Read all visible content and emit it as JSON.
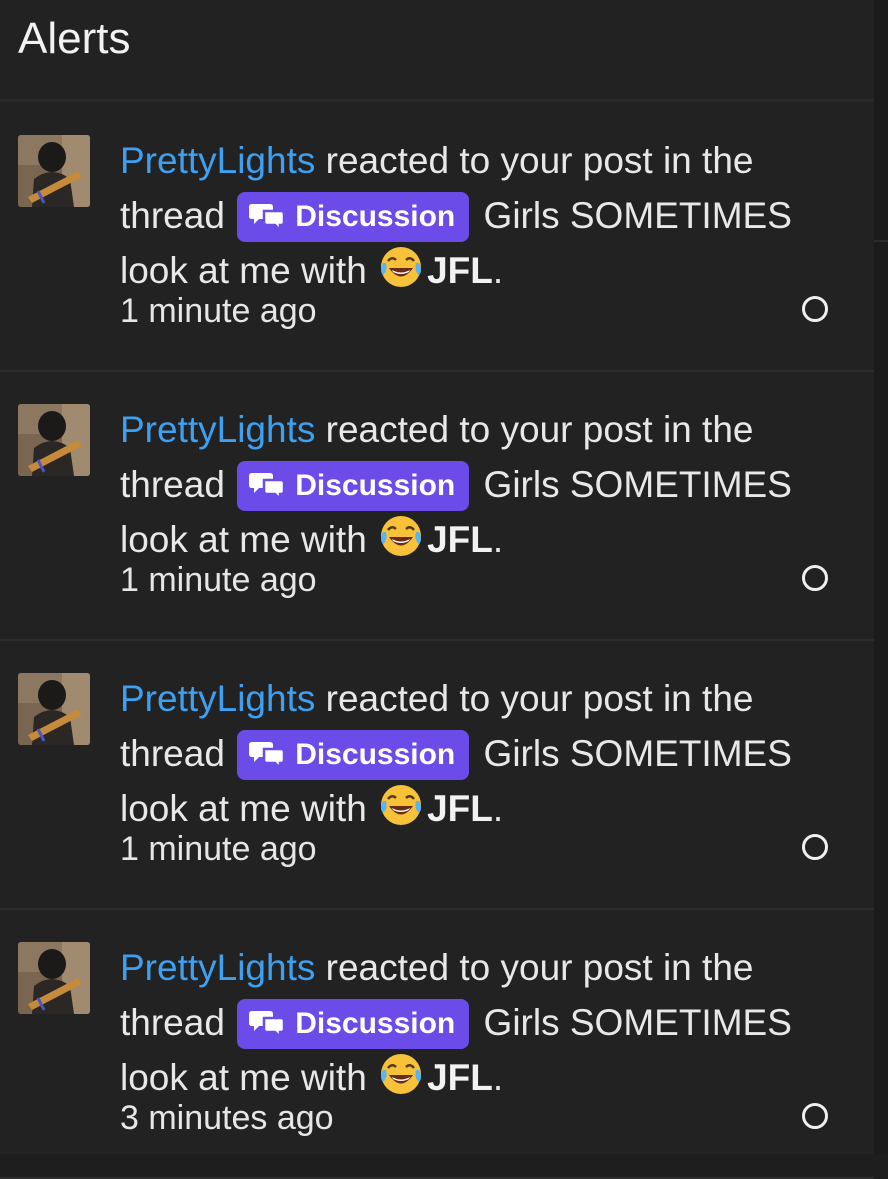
{
  "header": {
    "title": "Alerts"
  },
  "alerts": [
    {
      "user": "PrettyLights",
      "text_before": "reacted to your post in the thread",
      "prefix": "Discussion",
      "thread_title": "Girls SOMETIMES look at me with",
      "reaction_icon": "face-with-tears-of-joy-icon",
      "reaction": "JFL",
      "period": ".",
      "time": "1 minute ago"
    },
    {
      "user": "PrettyLights",
      "text_before": "reacted to your post in the thread",
      "prefix": "Discussion",
      "thread_title": "Girls SOMETIMES look at me with",
      "reaction_icon": "face-with-tears-of-joy-icon",
      "reaction": "JFL",
      "period": ".",
      "time": "1 minute ago"
    },
    {
      "user": "PrettyLights",
      "text_before": "reacted to your post in the thread",
      "prefix": "Discussion",
      "thread_title": "Girls SOMETIMES look at me with",
      "reaction_icon": "face-with-tears-of-joy-icon",
      "reaction": "JFL",
      "period": ".",
      "time": "1 minute ago"
    },
    {
      "user": "PrettyLights",
      "text_before": "reacted to your post in the thread",
      "prefix": "Discussion",
      "thread_title": "Girls SOMETIMES look at me with",
      "reaction_icon": "face-with-tears-of-joy-icon",
      "reaction": "JFL",
      "period": ".",
      "time": "3 minutes ago"
    }
  ],
  "colors": {
    "background": "#222222",
    "user_link": "#3ea0f0",
    "prefix_badge": "#6b4ce8"
  }
}
